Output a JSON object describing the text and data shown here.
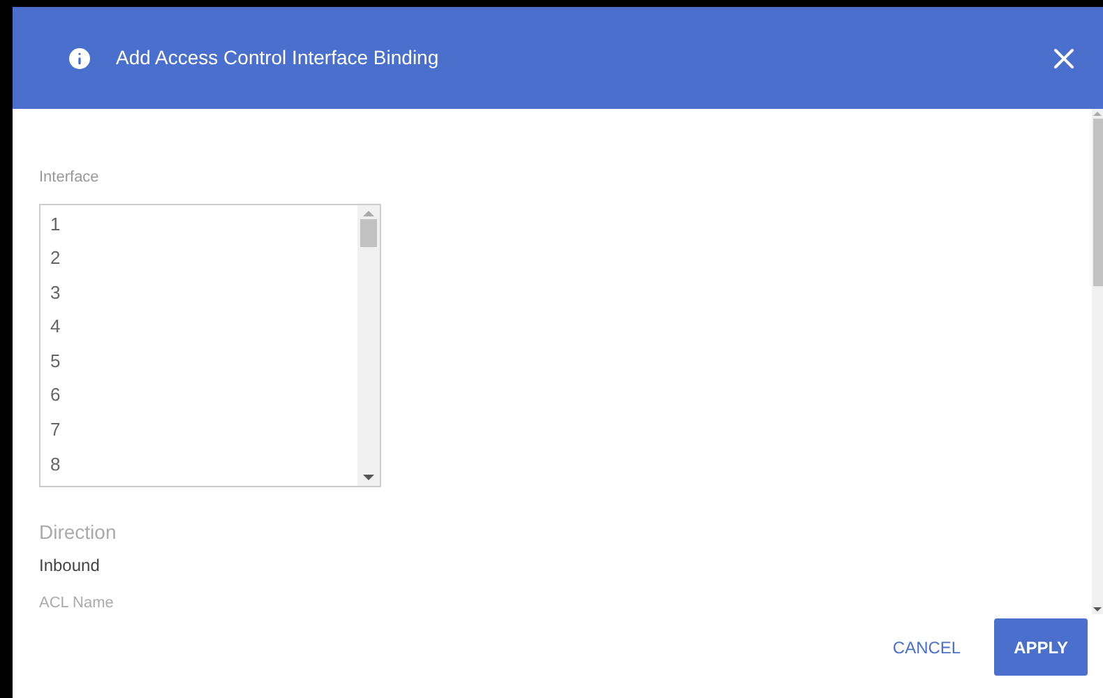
{
  "dialog": {
    "title": "Add Access Control Interface Binding"
  },
  "interface": {
    "label": "Interface",
    "options": [
      {
        "text": "1"
      },
      {
        "text": "2"
      },
      {
        "text": "3"
      },
      {
        "text": "4"
      },
      {
        "text": "5"
      },
      {
        "text": "6"
      },
      {
        "text": "7"
      },
      {
        "text": "8"
      }
    ]
  },
  "direction": {
    "label": "Direction",
    "value": "Inbound"
  },
  "acl_name": {
    "label": "ACL Name"
  },
  "buttons": {
    "cancel": "CANCEL",
    "apply": "APPLY"
  }
}
